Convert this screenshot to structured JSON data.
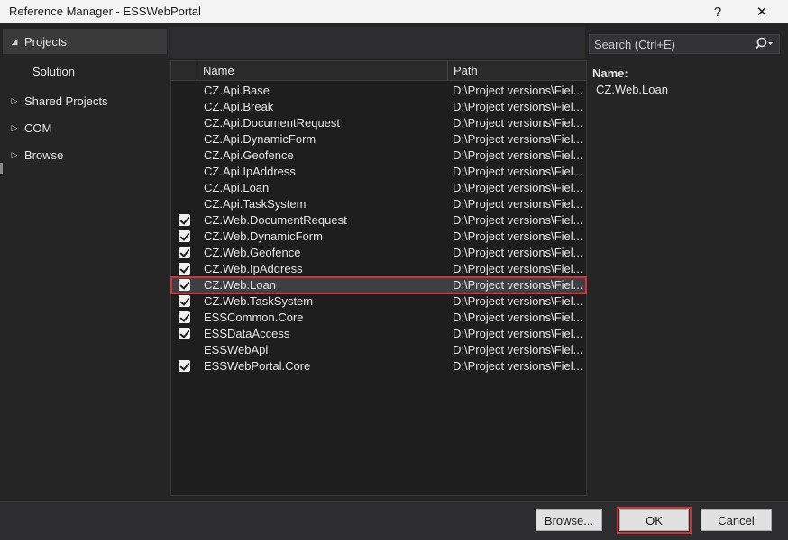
{
  "window": {
    "title": "Reference Manager - ESSWebPortal",
    "help_label": "?",
    "close_label": "✕"
  },
  "sidebar": {
    "items": [
      {
        "label": "Projects",
        "caret": "◢"
      },
      {
        "label": "Solution",
        "caret": ""
      },
      {
        "label": "Shared Projects",
        "caret": "▷"
      },
      {
        "label": "COM",
        "caret": "▷"
      },
      {
        "label": "Browse",
        "caret": "▷"
      }
    ]
  },
  "search": {
    "placeholder": "Search (Ctrl+E)",
    "icon": "search-icon"
  },
  "list": {
    "columns": [
      "Name",
      "Path"
    ],
    "rows": [
      {
        "name": "CZ.Api.Base",
        "path": "D:\\Project versions\\Fiel...",
        "checked": false
      },
      {
        "name": "CZ.Api.Break",
        "path": "D:\\Project versions\\Fiel...",
        "checked": false
      },
      {
        "name": "CZ.Api.DocumentRequest",
        "path": "D:\\Project versions\\Fiel...",
        "checked": false
      },
      {
        "name": "CZ.Api.DynamicForm",
        "path": "D:\\Project versions\\Fiel...",
        "checked": false
      },
      {
        "name": "CZ.Api.Geofence",
        "path": "D:\\Project versions\\Fiel...",
        "checked": false
      },
      {
        "name": "CZ.Api.IpAddress",
        "path": "D:\\Project versions\\Fiel...",
        "checked": false
      },
      {
        "name": "CZ.Api.Loan",
        "path": "D:\\Project versions\\Fiel...",
        "checked": false
      },
      {
        "name": "CZ.Api.TaskSystem",
        "path": "D:\\Project versions\\Fiel...",
        "checked": false
      },
      {
        "name": "CZ.Web.DocumentRequest",
        "path": "D:\\Project versions\\Fiel...",
        "checked": true
      },
      {
        "name": "CZ.Web.DynamicForm",
        "path": "D:\\Project versions\\Fiel...",
        "checked": true
      },
      {
        "name": "CZ.Web.Geofence",
        "path": "D:\\Project versions\\Fiel...",
        "checked": true
      },
      {
        "name": "CZ.Web.IpAddress",
        "path": "D:\\Project versions\\Fiel...",
        "checked": true
      },
      {
        "name": "CZ.Web.Loan",
        "path": "D:\\Project versions\\Fiel...",
        "checked": true
      },
      {
        "name": "CZ.Web.TaskSystem",
        "path": "D:\\Project versions\\Fiel...",
        "checked": true
      },
      {
        "name": "ESSCommon.Core",
        "path": "D:\\Project versions\\Fiel...",
        "checked": true
      },
      {
        "name": "ESSDataAccess",
        "path": "D:\\Project versions\\Fiel...",
        "checked": true
      },
      {
        "name": "ESSWebApi",
        "path": "D:\\Project versions\\Fiel...",
        "checked": false
      },
      {
        "name": "ESSWebPortal.Core",
        "path": "D:\\Project versions\\Fiel...",
        "checked": true
      }
    ]
  },
  "details": {
    "name_label": "Name:",
    "name_value": "CZ.Web.Loan"
  },
  "footer": {
    "browse_label": "Browse...",
    "ok_label": "OK",
    "cancel_label": "Cancel"
  },
  "colors": {
    "accent_highlight": "#d13438",
    "background": "#252526",
    "selected_row": "#3f3f46"
  }
}
